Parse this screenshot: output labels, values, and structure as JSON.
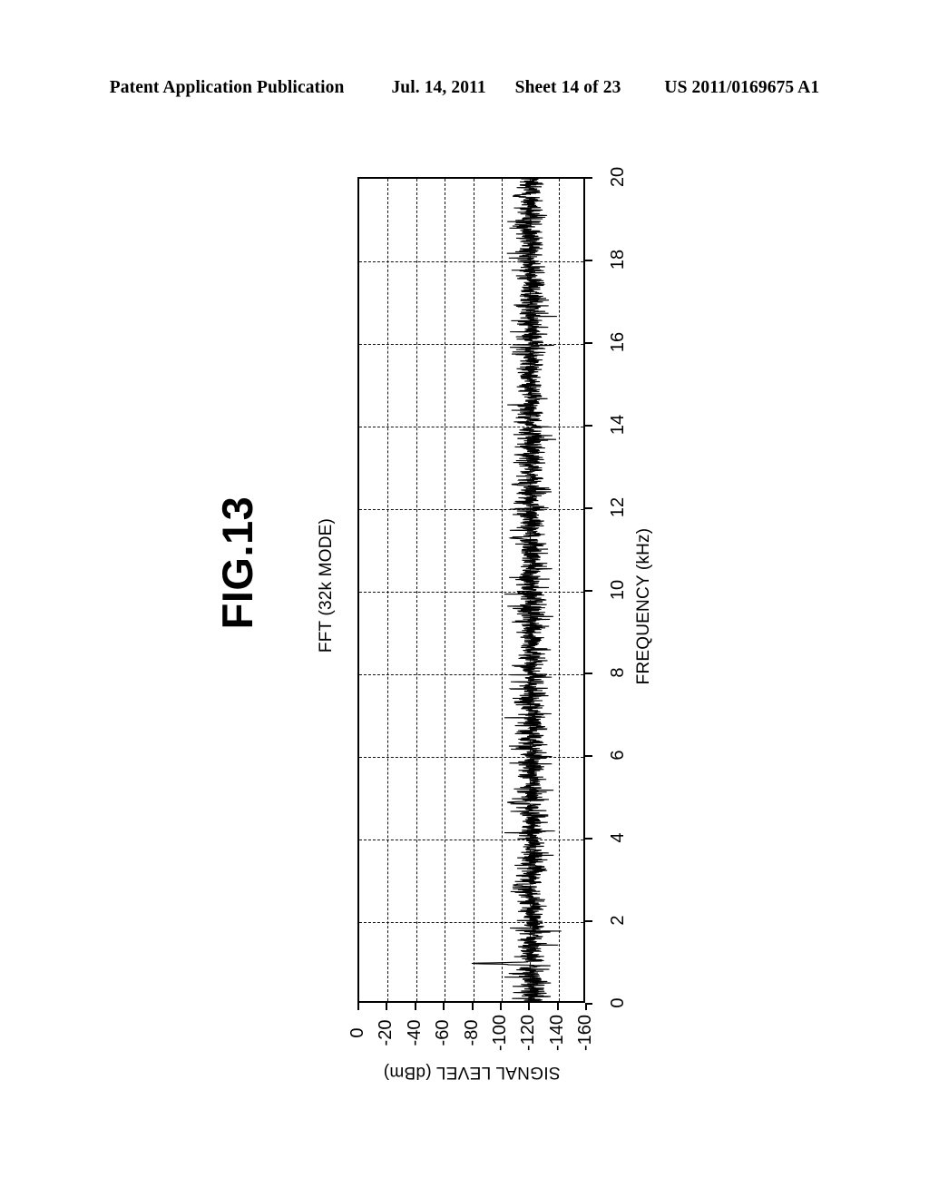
{
  "header": {
    "publication": "Patent Application Publication",
    "date": "Jul. 14, 2011",
    "sheet": "Sheet 14 of 23",
    "number": "US 2011/0169675 A1"
  },
  "figure": {
    "label": "FIG.13"
  },
  "chart_data": {
    "type": "line",
    "title": "FFT (32k MODE)",
    "xlabel": "FREQUENCY (kHz)",
    "ylabel": "SIGNAL LEVEL (dBm)",
    "xlim": [
      0,
      20
    ],
    "ylim": [
      -160,
      0
    ],
    "xticks": [
      0,
      2,
      4,
      6,
      8,
      10,
      12,
      14,
      16,
      18,
      20
    ],
    "xtick_labels": [
      "0",
      "2",
      "4",
      "6",
      "8",
      "10",
      "12",
      "14",
      "16",
      "18",
      "20"
    ],
    "yticks": [
      0,
      -20,
      -40,
      -60,
      -80,
      -100,
      -120,
      -140,
      -160
    ],
    "ytick_labels": [
      "0",
      "-20",
      "-40",
      "-60",
      "-80",
      "-100",
      "-120",
      "-140",
      "-160"
    ],
    "grid": true,
    "grid_style": "dashed",
    "legend": null,
    "rotation_deg": -90,
    "series": [
      {
        "name": "FFT spectrum (32k mode)",
        "color": "#000000",
        "noise_floor_dbm": -120,
        "noise_band_dbm": [
          -110,
          -138
        ],
        "peaks": [
          {
            "frequency_khz": 1.0,
            "level_dbm": -79
          },
          {
            "frequency_khz": 2.9,
            "level_dbm": -108
          },
          {
            "frequency_khz": 4.9,
            "level_dbm": -104
          },
          {
            "frequency_khz": 11.3,
            "level_dbm": -106
          },
          {
            "frequency_khz": 12.6,
            "level_dbm": -107
          },
          {
            "frequency_khz": 19.6,
            "level_dbm": -109
          }
        ]
      }
    ]
  }
}
